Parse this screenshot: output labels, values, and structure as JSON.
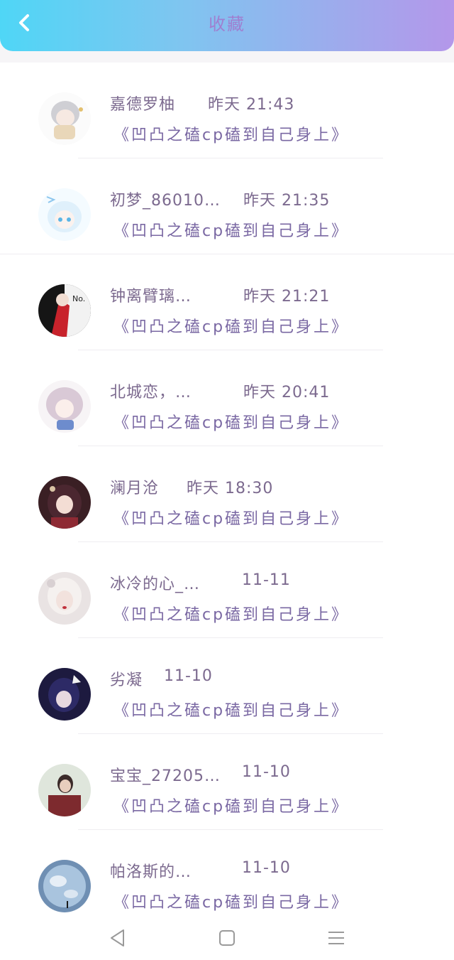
{
  "header": {
    "title": "收藏",
    "back_icon": "chevron-left-icon"
  },
  "colors": {
    "gradient_start": "#4fd6f6",
    "gradient_end": "#b497ea"
  },
  "items": [
    {
      "name": "嘉德罗柚",
      "time": "昨天 21:43",
      "post": "《凹凸之磕cp磕到自己身上》"
    },
    {
      "name": "初梦_86010…",
      "time": "昨天 21:35",
      "post": "《凹凸之磕cp磕到自己身上》"
    },
    {
      "name": "钟离臂璃…",
      "time": "昨天 21:21",
      "post": "《凹凸之磕cp磕到自己身上》"
    },
    {
      "name": "北城恋，…",
      "time": "昨天 20:41",
      "post": "《凹凸之磕cp磕到自己身上》"
    },
    {
      "name": "澜月沧",
      "time": "昨天 18:30",
      "post": "《凹凸之磕cp磕到自己身上》"
    },
    {
      "name": "冰冷的心_…",
      "time": "11-11",
      "post": "《凹凸之磕cp磕到自己身上》"
    },
    {
      "name": "劣凝",
      "time": "11-10",
      "post": "《凹凸之磕cp磕到自己身上》"
    },
    {
      "name": "宝宝_27205…",
      "time": "11-10",
      "post": "《凹凸之磕cp磕到自己身上》"
    },
    {
      "name": "帕洛斯的…",
      "time": "11-10",
      "post": "《凹凸之磕cp磕到自己身上》"
    }
  ],
  "navbar": {
    "back_icon": "triangle-back-icon",
    "home_icon": "square-home-icon",
    "menu_icon": "menu-lines-icon"
  }
}
